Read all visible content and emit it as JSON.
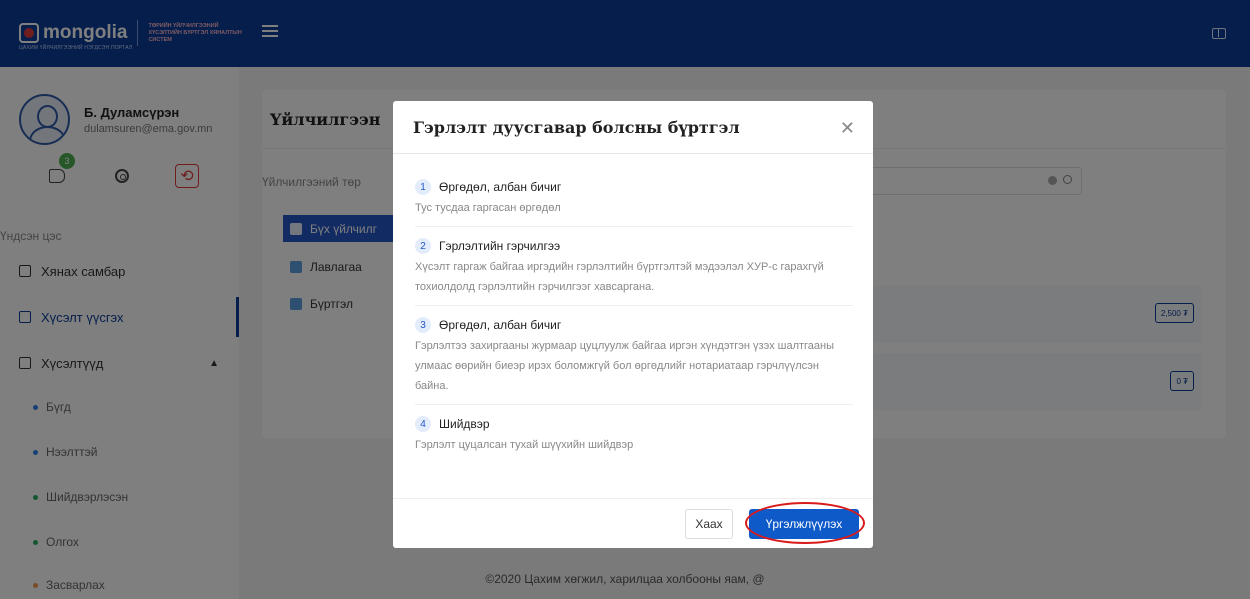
{
  "header": {
    "logo_text": "mongolia",
    "logo_tagline": "ЦАХИМ ҮЙЛЧИЛГЭЭНИЙ НЭГДСЭН ПОРТАЛ",
    "system_name": "ТӨРИЙН ҮЙЛЧИЛГЭЭНИЙ ХҮСЭЛТИЙН БҮРТГЭЛ ХЯНАЛТЫН СИСТЕМ"
  },
  "profile": {
    "name": "Б. Дуламсүрэн",
    "email": "dulamsuren@ema.gov.mn",
    "notification_count": "3"
  },
  "sidebar": {
    "section_label": "Үндсэн цэс",
    "items": [
      {
        "label": "Хянах самбар"
      },
      {
        "label": "Хүсэлт үүсгэх"
      },
      {
        "label": "Хүсэлтүүд"
      }
    ],
    "sub_items": [
      {
        "label": "Бүгд",
        "color": "#2f80ed"
      },
      {
        "label": "Нээлттэй",
        "color": "#2f80ed"
      },
      {
        "label": "Шийдвэрлэсэн",
        "color": "#27ae60"
      },
      {
        "label": "Олгох",
        "color": "#27ae60"
      },
      {
        "label": "Засварлах",
        "color": "#f2994a"
      }
    ]
  },
  "main": {
    "title": "Үйлчилгээн",
    "search_label": "Үйлчилгээний төр",
    "categories": [
      {
        "label": "Бүх үйлчилг"
      },
      {
        "label": "Лавлагаа"
      },
      {
        "label": "Бүртгэл"
      }
    ],
    "prices": [
      "2,500 ₮",
      "0 ₮"
    ]
  },
  "modal": {
    "title": "Гэрлэлт дуусгавар болсны бүртгэл",
    "steps": [
      {
        "num": "1",
        "title": "Өргөдөл, албан бичиг",
        "desc": "Тус тусдаа гаргасан өргөдөл"
      },
      {
        "num": "2",
        "title": "Гэрлэлтийн гэрчилгээ",
        "desc": "Хүсэлт гаргаж байгаа иргэдийн гэрлэлтийн бүртгэлтэй мэдээлэл ХУР-с гарахгүй тохиолдолд гэрлэлтийн гэрчилгээг хавсаргана."
      },
      {
        "num": "3",
        "title": "Өргөдөл, албан бичиг",
        "desc": "Гэрлэлтээ захиргааны журмаар цуцлуулж байгаа иргэн хүндэтгэн үзэх шалтгааны улмаас өөрийн биеэр ирэх боломжгүй бол өргөдлийг нотариатаар гэрчлүүлсэн байна."
      },
      {
        "num": "4",
        "title": "Шийдвэр",
        "desc": "Гэрлэлт цуцалсан тухай шүүхийн шийдвэр"
      }
    ],
    "close_label": "Хаах",
    "continue_label": "Үргэлжлүүлэх"
  },
  "footer": {
    "text": "©2020 Цахим хөгжил, харилцаа холбооны яам, @"
  }
}
